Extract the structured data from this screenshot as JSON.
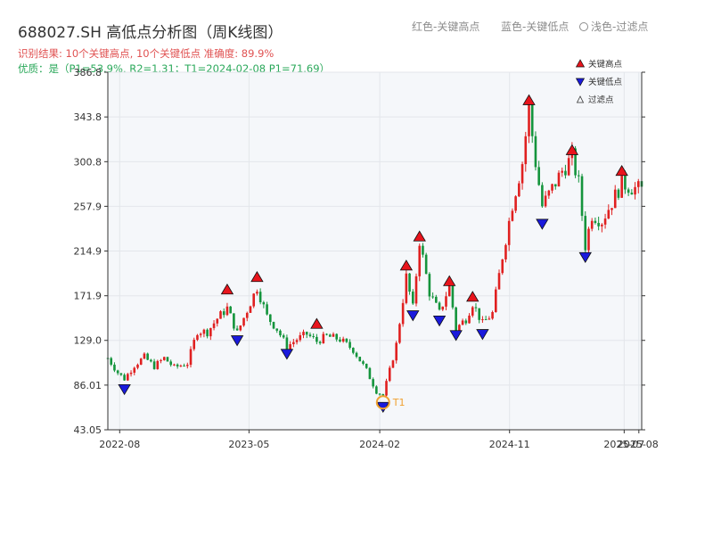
{
  "header": {
    "title": "688027.SH 高低点分析图（周K线图）",
    "result": "识别结果: 10个关键高点, 10个关键低点   准确度: 89.9%",
    "quality": "优质：是（P1=53.9%, R2=1.31；T1=2024-02-08 P1=71.69）",
    "legend_red": "红色-关键高点",
    "legend_blue": "蓝色-关键低点",
    "legend_light": "浅色-过滤点"
  },
  "colors": {
    "up": "#e02020",
    "down": "#14943c",
    "high_marker": "#e8141c",
    "low_marker": "#1a1adc",
    "t1": "#f0a030",
    "plot_bg": "#f5f7fa",
    "grid": "#e3e6eb"
  },
  "chart_data": {
    "type": "candlestick",
    "title": "688027.SH 高低点分析图（周K线图）",
    "x_range": [
      "2022-07-07",
      "2025-08-07"
    ],
    "ylim": [
      43.05,
      386.8
    ],
    "y_ticks": [
      "43.05",
      "86.01",
      "129.0",
      "171.9",
      "214.9",
      "257.9",
      "300.8",
      "343.8",
      "386.8"
    ],
    "x_ticks": [
      {
        "date": "2022-08-01",
        "label": "2022-08"
      },
      {
        "date": "2023-05-01",
        "label": "2023-05"
      },
      {
        "date": "2024-02-01",
        "label": "2024-02"
      },
      {
        "date": "2024-11-01",
        "label": "2024-11"
      },
      {
        "date": "2025-07-01",
        "label": "2025-07"
      },
      {
        "date": "2025-08-01",
        "label": "2025-08"
      }
    ],
    "price_path": [
      [
        "2022-07-07",
        112
      ],
      [
        "2022-07-28",
        98
      ],
      [
        "2022-08-11",
        92
      ],
      [
        "2022-09-01",
        105
      ],
      [
        "2022-09-22",
        113
      ],
      [
        "2022-10-13",
        104
      ],
      [
        "2022-11-03",
        112
      ],
      [
        "2022-11-24",
        103
      ],
      [
        "2022-12-22",
        107
      ],
      [
        "2023-01-12",
        138
      ],
      [
        "2023-02-02",
        137
      ],
      [
        "2023-02-23",
        150
      ],
      [
        "2023-03-16",
        160
      ],
      [
        "2023-04-06",
        136
      ],
      [
        "2023-04-27",
        158
      ],
      [
        "2023-05-18",
        180
      ],
      [
        "2023-06-08",
        152
      ],
      [
        "2023-06-29",
        140
      ],
      [
        "2023-07-20",
        123
      ],
      [
        "2023-08-10",
        130
      ],
      [
        "2023-08-31",
        135
      ],
      [
        "2023-09-21",
        128
      ],
      [
        "2023-10-12",
        133
      ],
      [
        "2023-11-09",
        130
      ],
      [
        "2023-12-07",
        120
      ],
      [
        "2024-01-04",
        100
      ],
      [
        "2024-01-25",
        80
      ],
      [
        "2024-02-08",
        76
      ],
      [
        "2024-02-22",
        100
      ],
      [
        "2024-03-07",
        125
      ],
      [
        "2024-03-28",
        190
      ],
      [
        "2024-04-11",
        160
      ],
      [
        "2024-04-25",
        225
      ],
      [
        "2024-05-16",
        175
      ],
      [
        "2024-06-06",
        155
      ],
      [
        "2024-06-27",
        182
      ],
      [
        "2024-07-11",
        140
      ],
      [
        "2024-08-01",
        150
      ],
      [
        "2024-08-15",
        165
      ],
      [
        "2024-09-05",
        145
      ],
      [
        "2024-09-26",
        155
      ],
      [
        "2024-10-17",
        210
      ],
      [
        "2024-11-07",
        260
      ],
      [
        "2024-11-28",
        300
      ],
      [
        "2024-12-12",
        352
      ],
      [
        "2024-12-26",
        300
      ],
      [
        "2025-01-09",
        258
      ],
      [
        "2025-01-30",
        275
      ],
      [
        "2025-02-20",
        292
      ],
      [
        "2025-03-13",
        305
      ],
      [
        "2025-03-27",
        280
      ],
      [
        "2025-04-10",
        220
      ],
      [
        "2025-04-24",
        250
      ],
      [
        "2025-05-15",
        244
      ],
      [
        "2025-06-05",
        262
      ],
      [
        "2025-06-26",
        280
      ],
      [
        "2025-07-17",
        276
      ],
      [
        "2025-08-07",
        274
      ]
    ],
    "key_highs": [
      {
        "date": "2023-03-16",
        "value": 171
      },
      {
        "date": "2023-05-18",
        "value": 183
      },
      {
        "date": "2023-09-21",
        "value": 138
      },
      {
        "date": "2024-03-28",
        "value": 194
      },
      {
        "date": "2024-04-25",
        "value": 222
      },
      {
        "date": "2024-06-27",
        "value": 179
      },
      {
        "date": "2024-08-15",
        "value": 164
      },
      {
        "date": "2024-12-12",
        "value": 353
      },
      {
        "date": "2025-03-13",
        "value": 305
      },
      {
        "date": "2025-06-26",
        "value": 285
      }
    ],
    "key_lows": [
      {
        "date": "2022-08-11",
        "value": 89
      },
      {
        "date": "2023-04-06",
        "value": 136
      },
      {
        "date": "2023-07-20",
        "value": 123
      },
      {
        "date": "2024-02-08",
        "value": 72
      },
      {
        "date": "2024-04-11",
        "value": 160
      },
      {
        "date": "2024-06-06",
        "value": 155
      },
      {
        "date": "2024-07-11",
        "value": 141
      },
      {
        "date": "2024-09-05",
        "value": 142
      },
      {
        "date": "2025-01-09",
        "value": 248
      },
      {
        "date": "2025-04-10",
        "value": 216
      }
    ],
    "t1_point": {
      "date": "2024-02-08",
      "value": 72,
      "label": "T1"
    },
    "legend": [
      {
        "symbol": "triangle-up",
        "label": "关键高点"
      },
      {
        "symbol": "triangle-down",
        "label": "关键低点"
      },
      {
        "symbol": "triangle-up-outline",
        "label": "过滤点"
      }
    ],
    "legend_position": "top-right",
    "grid": true
  }
}
